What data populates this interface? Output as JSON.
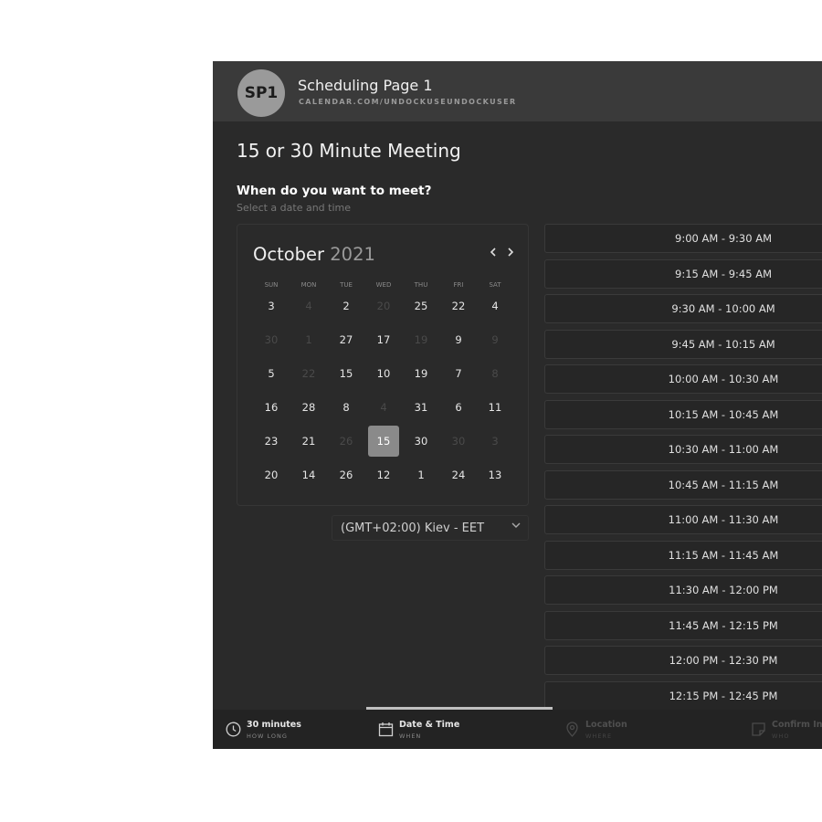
{
  "header": {
    "avatar_initials": "SP1",
    "page_name": "Scheduling Page 1",
    "page_url": "CALENDAR.COM/UNDOCKUSEUNDOCKUSER"
  },
  "meeting": {
    "title": "15 or 30 Minute Meeting",
    "question": "When do you want to meet?",
    "hint": "Select a date and time"
  },
  "calendar": {
    "month": "October",
    "year": "2021",
    "prev_icon": "chevron-left-icon",
    "next_icon": "chevron-right-icon",
    "weekdays": [
      "SUN",
      "MON",
      "TUE",
      "WED",
      "THU",
      "FRI",
      "SAT"
    ],
    "weeks": [
      [
        {
          "d": "3"
        },
        {
          "d": "4",
          "muted": true
        },
        {
          "d": "2"
        },
        {
          "d": "20",
          "muted": true
        },
        {
          "d": "25"
        },
        {
          "d": "22"
        },
        {
          "d": "4"
        }
      ],
      [
        {
          "d": "30",
          "muted": true
        },
        {
          "d": "1",
          "muted": true
        },
        {
          "d": "27"
        },
        {
          "d": "17"
        },
        {
          "d": "19",
          "muted": true
        },
        {
          "d": "9"
        },
        {
          "d": "9",
          "muted": true
        }
      ],
      [
        {
          "d": "5"
        },
        {
          "d": "22",
          "muted": true
        },
        {
          "d": "15"
        },
        {
          "d": "10"
        },
        {
          "d": "19"
        },
        {
          "d": "7"
        },
        {
          "d": "8",
          "muted": true
        }
      ],
      [
        {
          "d": "16"
        },
        {
          "d": "28"
        },
        {
          "d": "8"
        },
        {
          "d": "4",
          "muted": true
        },
        {
          "d": "31"
        },
        {
          "d": "6"
        },
        {
          "d": "11"
        }
      ],
      [
        {
          "d": "23"
        },
        {
          "d": "21"
        },
        {
          "d": "26",
          "muted": true
        },
        {
          "d": "15",
          "selected": true
        },
        {
          "d": "30"
        },
        {
          "d": "30",
          "muted": true
        },
        {
          "d": "3",
          "muted": true
        }
      ],
      [
        {
          "d": "20"
        },
        {
          "d": "14"
        },
        {
          "d": "26"
        },
        {
          "d": "12"
        },
        {
          "d": "1"
        },
        {
          "d": "24"
        },
        {
          "d": "13"
        }
      ]
    ],
    "selected_color": "#8a8a8a"
  },
  "timezone": {
    "selected": "(GMT+02:00) Kiev - EET",
    "icon": "chevron-down-icon"
  },
  "time_slots": [
    "9:00 AM - 9:30 AM",
    "9:15 AM - 9:45 AM",
    "9:30 AM - 10:00 AM",
    "9:45 AM - 10:15 AM",
    "10:00 AM - 10:30 AM",
    "10:15 AM - 10:45 AM",
    "10:30 AM - 11:00 AM",
    "10:45 AM - 11:15 AM",
    "11:00 AM - 11:30 AM",
    "11:15 AM - 11:45 AM",
    "11:30 AM - 12:00 PM",
    "11:45 AM - 12:15 PM",
    "12:00 PM - 12:30 PM",
    "12:15 PM - 12:45 PM"
  ],
  "steps": [
    {
      "icon": "clock-icon",
      "title": "30 minutes",
      "subtitle": "HOW LONG",
      "state": "done"
    },
    {
      "icon": "calendar-icon",
      "title": "Date & Time",
      "subtitle": "WHEN",
      "state": "active"
    },
    {
      "icon": "location-pin-icon",
      "title": "Location",
      "subtitle": "WHERE",
      "state": "disabled"
    },
    {
      "icon": "note-icon",
      "title": "Confirm In",
      "subtitle": "WHO",
      "state": "disabled"
    }
  ]
}
